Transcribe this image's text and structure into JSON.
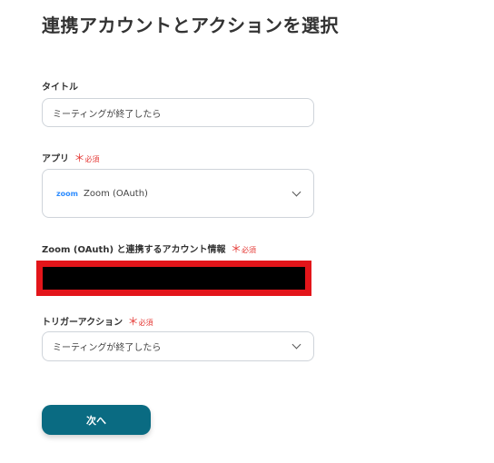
{
  "page_title": "連携アカウントとアクションを選択",
  "required_mark": "＊",
  "required_text": "必須",
  "form": {
    "title": {
      "label": "タイトル",
      "value": "ミーティングが終了したら"
    },
    "app": {
      "label": "アプリ",
      "logo_text": "zoom",
      "value": "Zoom (OAuth)"
    },
    "account": {
      "label": "Zoom (OAuth) と連携するアカウント情報"
    },
    "trigger": {
      "label": "トリガーアクション",
      "value": "ミーティングが終了したら"
    }
  },
  "next_button_label": "次へ",
  "colors": {
    "primary": "#0a6b82",
    "required": "#e53935",
    "redaction_border": "#e3151a",
    "zoom_brand": "#2d8cff"
  }
}
